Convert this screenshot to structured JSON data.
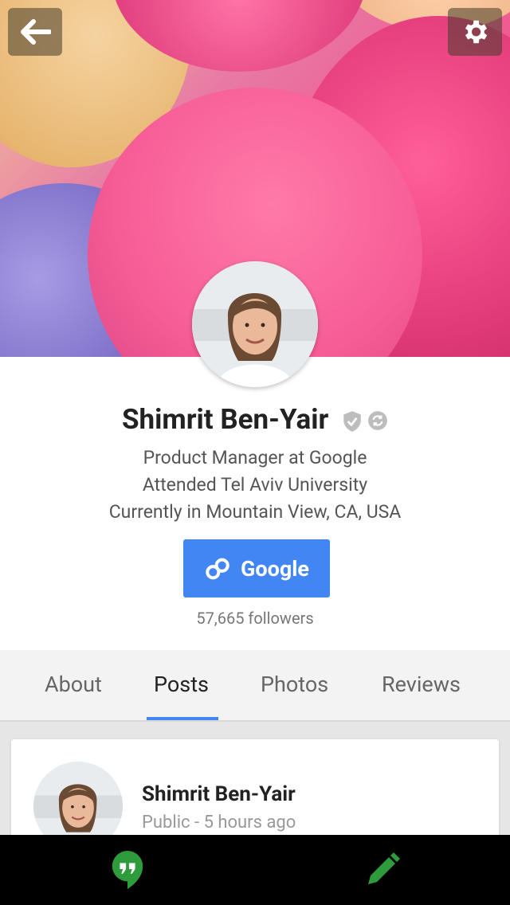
{
  "cover": {
    "back_icon": "back-arrow-icon",
    "settings_icon": "gear-icon"
  },
  "profile": {
    "name": "Shimrit Ben-Yair",
    "badges": [
      "verified-shield-icon",
      "sync-icon"
    ],
    "lines": [
      "Product Manager at Google",
      "Attended Tel Aviv University",
      "Currently in Mountain View, CA, USA"
    ],
    "button_label": "Google",
    "followers": "57,665 followers",
    "accent_color": "#4286f4"
  },
  "tabs": [
    {
      "label": "About"
    },
    {
      "label": "Posts",
      "active": true
    },
    {
      "label": "Photos"
    },
    {
      "label": "Reviews"
    }
  ],
  "post": {
    "author": "Shimrit Ben-Yair",
    "meta": "Public - 5 hours ago"
  },
  "bottom_bar": {
    "left_icon": "hangouts-icon",
    "right_icon": "pencil-icon",
    "icon_color": "#2e9b3c"
  }
}
